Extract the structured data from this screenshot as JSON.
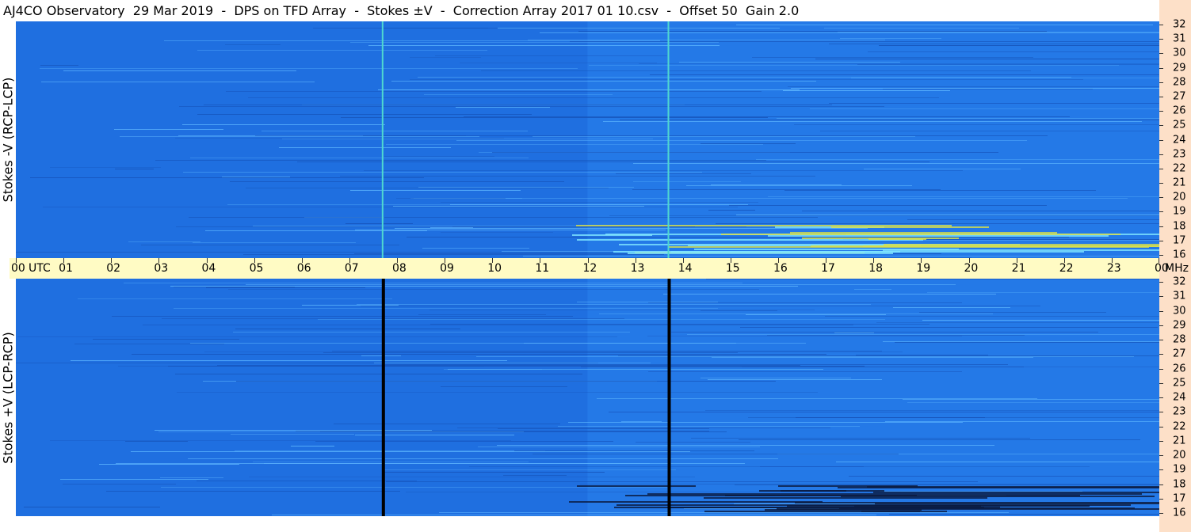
{
  "title": "AJ4CO Observatory  29 Mar 2019  -  DPS on TFD Array  -  Stokes ±V  -  Correction Array 2017 01 10.csv  -  Offset 50  Gain 2.0",
  "colors": {
    "background_blue": "#1f6fe0",
    "time_band": "#fffbc4",
    "right_strip": "#fde0c8"
  },
  "chart_data": [
    {
      "type": "heatmap",
      "title": "",
      "ylabel": "Stokes -V (RCP-LCP)",
      "xlabel": "UTC",
      "x_ticks": [
        "00",
        "01",
        "02",
        "03",
        "04",
        "05",
        "06",
        "07",
        "08",
        "09",
        "10",
        "11",
        "12",
        "13",
        "14",
        "15",
        "16",
        "17",
        "18",
        "19",
        "20",
        "21",
        "22",
        "23",
        "00"
      ],
      "y_ticks": [
        "32",
        "31",
        "30",
        "29",
        "28",
        "27",
        "26",
        "25",
        "24",
        "23",
        "22",
        "21",
        "20",
        "19",
        "18",
        "17",
        "16"
      ],
      "x_range_hours": [
        0,
        24
      ],
      "y_range_mhz": [
        16,
        32
      ],
      "y_unit": "MHz",
      "vertical_lines_utc": [
        7.68,
        13.68
      ],
      "vertical_line_color": "#4fd8d0",
      "grid": false
    },
    {
      "type": "heatmap",
      "title": "",
      "ylabel": "Stokes +V (LCP-RCP)",
      "xlabel": "UTC",
      "x_ticks": [
        "00",
        "01",
        "02",
        "03",
        "04",
        "05",
        "06",
        "07",
        "08",
        "09",
        "10",
        "11",
        "12",
        "13",
        "14",
        "15",
        "16",
        "17",
        "18",
        "19",
        "20",
        "21",
        "22",
        "23",
        "00"
      ],
      "y_ticks": [
        "32",
        "31",
        "30",
        "29",
        "28",
        "27",
        "26",
        "25",
        "24",
        "23",
        "22",
        "21",
        "20",
        "19",
        "18",
        "17",
        "16"
      ],
      "x_range_hours": [
        0,
        24
      ],
      "y_range_mhz": [
        16,
        32
      ],
      "y_unit": "MHz",
      "vertical_lines_utc": [
        7.68,
        13.68
      ],
      "vertical_line_color": "#000000",
      "grid": false
    }
  ],
  "time_axis": {
    "utc_label": "UTC",
    "mhz_label": "MHz"
  }
}
